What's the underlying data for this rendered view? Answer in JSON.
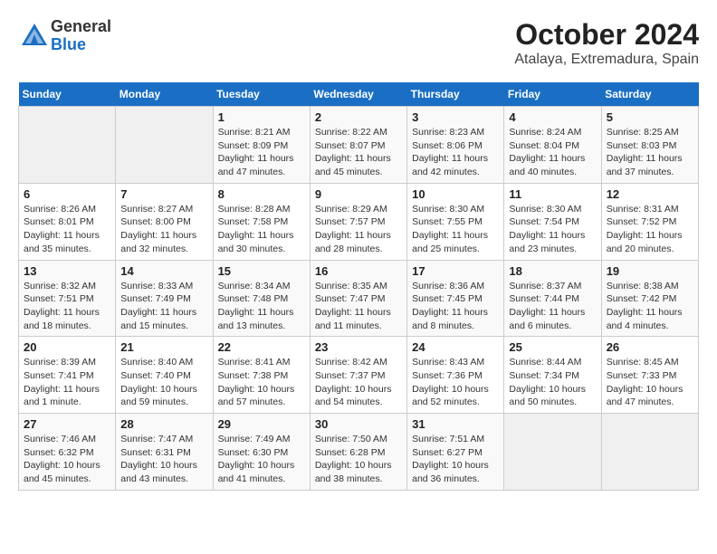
{
  "header": {
    "logo": {
      "line1": "General",
      "line2": "Blue"
    },
    "title": "October 2024",
    "location": "Atalaya, Extremadura, Spain"
  },
  "columns": [
    "Sunday",
    "Monday",
    "Tuesday",
    "Wednesday",
    "Thursday",
    "Friday",
    "Saturday"
  ],
  "weeks": [
    [
      {
        "day": "",
        "info": ""
      },
      {
        "day": "",
        "info": ""
      },
      {
        "day": "1",
        "info": "Sunrise: 8:21 AM\nSunset: 8:09 PM\nDaylight: 11 hours and 47 minutes."
      },
      {
        "day": "2",
        "info": "Sunrise: 8:22 AM\nSunset: 8:07 PM\nDaylight: 11 hours and 45 minutes."
      },
      {
        "day": "3",
        "info": "Sunrise: 8:23 AM\nSunset: 8:06 PM\nDaylight: 11 hours and 42 minutes."
      },
      {
        "day": "4",
        "info": "Sunrise: 8:24 AM\nSunset: 8:04 PM\nDaylight: 11 hours and 40 minutes."
      },
      {
        "day": "5",
        "info": "Sunrise: 8:25 AM\nSunset: 8:03 PM\nDaylight: 11 hours and 37 minutes."
      }
    ],
    [
      {
        "day": "6",
        "info": "Sunrise: 8:26 AM\nSunset: 8:01 PM\nDaylight: 11 hours and 35 minutes."
      },
      {
        "day": "7",
        "info": "Sunrise: 8:27 AM\nSunset: 8:00 PM\nDaylight: 11 hours and 32 minutes."
      },
      {
        "day": "8",
        "info": "Sunrise: 8:28 AM\nSunset: 7:58 PM\nDaylight: 11 hours and 30 minutes."
      },
      {
        "day": "9",
        "info": "Sunrise: 8:29 AM\nSunset: 7:57 PM\nDaylight: 11 hours and 28 minutes."
      },
      {
        "day": "10",
        "info": "Sunrise: 8:30 AM\nSunset: 7:55 PM\nDaylight: 11 hours and 25 minutes."
      },
      {
        "day": "11",
        "info": "Sunrise: 8:30 AM\nSunset: 7:54 PM\nDaylight: 11 hours and 23 minutes."
      },
      {
        "day": "12",
        "info": "Sunrise: 8:31 AM\nSunset: 7:52 PM\nDaylight: 11 hours and 20 minutes."
      }
    ],
    [
      {
        "day": "13",
        "info": "Sunrise: 8:32 AM\nSunset: 7:51 PM\nDaylight: 11 hours and 18 minutes."
      },
      {
        "day": "14",
        "info": "Sunrise: 8:33 AM\nSunset: 7:49 PM\nDaylight: 11 hours and 15 minutes."
      },
      {
        "day": "15",
        "info": "Sunrise: 8:34 AM\nSunset: 7:48 PM\nDaylight: 11 hours and 13 minutes."
      },
      {
        "day": "16",
        "info": "Sunrise: 8:35 AM\nSunset: 7:47 PM\nDaylight: 11 hours and 11 minutes."
      },
      {
        "day": "17",
        "info": "Sunrise: 8:36 AM\nSunset: 7:45 PM\nDaylight: 11 hours and 8 minutes."
      },
      {
        "day": "18",
        "info": "Sunrise: 8:37 AM\nSunset: 7:44 PM\nDaylight: 11 hours and 6 minutes."
      },
      {
        "day": "19",
        "info": "Sunrise: 8:38 AM\nSunset: 7:42 PM\nDaylight: 11 hours and 4 minutes."
      }
    ],
    [
      {
        "day": "20",
        "info": "Sunrise: 8:39 AM\nSunset: 7:41 PM\nDaylight: 11 hours and 1 minute."
      },
      {
        "day": "21",
        "info": "Sunrise: 8:40 AM\nSunset: 7:40 PM\nDaylight: 10 hours and 59 minutes."
      },
      {
        "day": "22",
        "info": "Sunrise: 8:41 AM\nSunset: 7:38 PM\nDaylight: 10 hours and 57 minutes."
      },
      {
        "day": "23",
        "info": "Sunrise: 8:42 AM\nSunset: 7:37 PM\nDaylight: 10 hours and 54 minutes."
      },
      {
        "day": "24",
        "info": "Sunrise: 8:43 AM\nSunset: 7:36 PM\nDaylight: 10 hours and 52 minutes."
      },
      {
        "day": "25",
        "info": "Sunrise: 8:44 AM\nSunset: 7:34 PM\nDaylight: 10 hours and 50 minutes."
      },
      {
        "day": "26",
        "info": "Sunrise: 8:45 AM\nSunset: 7:33 PM\nDaylight: 10 hours and 47 minutes."
      }
    ],
    [
      {
        "day": "27",
        "info": "Sunrise: 7:46 AM\nSunset: 6:32 PM\nDaylight: 10 hours and 45 minutes."
      },
      {
        "day": "28",
        "info": "Sunrise: 7:47 AM\nSunset: 6:31 PM\nDaylight: 10 hours and 43 minutes."
      },
      {
        "day": "29",
        "info": "Sunrise: 7:49 AM\nSunset: 6:30 PM\nDaylight: 10 hours and 41 minutes."
      },
      {
        "day": "30",
        "info": "Sunrise: 7:50 AM\nSunset: 6:28 PM\nDaylight: 10 hours and 38 minutes."
      },
      {
        "day": "31",
        "info": "Sunrise: 7:51 AM\nSunset: 6:27 PM\nDaylight: 10 hours and 36 minutes."
      },
      {
        "day": "",
        "info": ""
      },
      {
        "day": "",
        "info": ""
      }
    ]
  ]
}
